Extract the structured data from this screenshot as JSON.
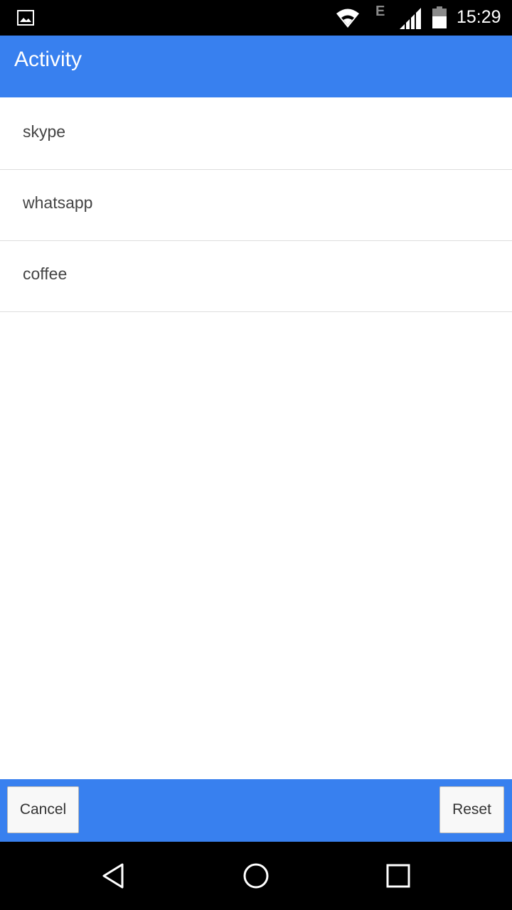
{
  "status_bar": {
    "network_type": "E",
    "time": "15:29",
    "icons": [
      "gallery-icon",
      "wifi-icon",
      "signal-icon",
      "battery-icon"
    ]
  },
  "app_bar": {
    "title": "Activity",
    "color": "#3880ef"
  },
  "list": {
    "items": [
      {
        "label": "skype"
      },
      {
        "label": "whatsapp"
      },
      {
        "label": "coffee"
      }
    ]
  },
  "footer": {
    "cancel_label": "Cancel",
    "reset_label": "Reset"
  },
  "nav_bar": {
    "icons": [
      "back-icon",
      "home-icon",
      "recents-icon"
    ]
  }
}
